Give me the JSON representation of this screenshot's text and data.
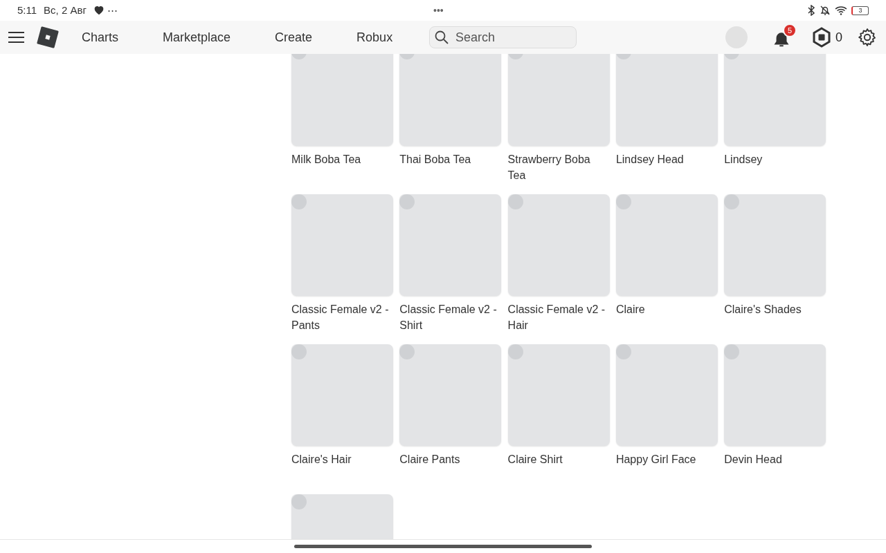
{
  "status_bar": {
    "time": "5:11",
    "date": "Вс, 2 Авг",
    "more": "⋯",
    "center_dots": "•••",
    "battery": "3"
  },
  "nav": {
    "links": [
      {
        "label": "Charts"
      },
      {
        "label": "Marketplace"
      },
      {
        "label": "Create"
      },
      {
        "label": "Robux"
      }
    ],
    "search": {
      "placeholder": "Search"
    },
    "notifications": "5",
    "robux_balance": "0"
  },
  "items": [
    {
      "name": "Milk Boba Tea",
      "loading": true
    },
    {
      "name": "Thai Boba Tea",
      "loading": true
    },
    {
      "name": "Strawberry Boba Tea",
      "loading": true
    },
    {
      "name": "Lindsey Head",
      "loading": true
    },
    {
      "name": "Lindsey",
      "loading": true
    },
    {
      "name": "Classic Female v2 - Pants",
      "loading": true
    },
    {
      "name": "Classic Female v2 - Shirt",
      "loading": true
    },
    {
      "name": "Classic Female v2 - Hair",
      "loading": true
    },
    {
      "name": "Claire",
      "loading": true
    },
    {
      "name": "Claire's Shades",
      "loading": true
    },
    {
      "name": "Claire's Hair",
      "loading": true
    },
    {
      "name": "Claire Pants",
      "loading": true
    },
    {
      "name": "Claire Shirt",
      "loading": true
    },
    {
      "name": "Happy Girl Face",
      "loading": true
    },
    {
      "name": "Devin Head",
      "loading": true
    },
    {
      "loading": true
    }
  ]
}
